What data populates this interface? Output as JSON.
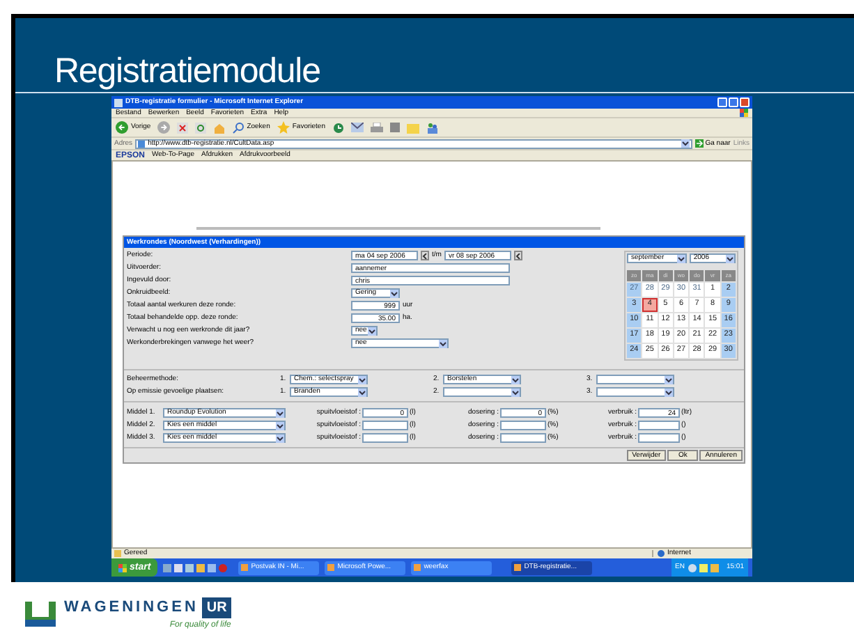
{
  "slide": {
    "title": "Registratiemodule",
    "logo_name": "WAGENINGEN",
    "logo_suffix": "UR",
    "tagline": "For quality of life"
  },
  "window": {
    "title": "DTB-registratie formulier - Microsoft Internet Explorer"
  },
  "menu": [
    "Bestand",
    "Bewerken",
    "Beeld",
    "Favorieten",
    "Extra",
    "Help"
  ],
  "toolbar": [
    {
      "kind": "back",
      "label": "Vorige"
    },
    {
      "kind": "forward"
    },
    {
      "kind": "stop"
    },
    {
      "kind": "refresh"
    },
    {
      "kind": "home"
    },
    {
      "kind": "search",
      "label": "Zoeken"
    },
    {
      "kind": "favorites",
      "label": "Favorieten"
    },
    {
      "kind": "history"
    },
    {
      "kind": "mail"
    },
    {
      "kind": "print"
    },
    {
      "kind": "edit"
    },
    {
      "kind": "folder"
    },
    {
      "kind": "people"
    }
  ],
  "address": {
    "label": "Adres",
    "value": "http://www.dtb-registratie.nl/CultData.asp",
    "go": "Ga naar",
    "links": "Links"
  },
  "epson_bar": {
    "brand": "EPSON",
    "items": [
      "Web-To-Page",
      "Afdrukken",
      "Afdrukvoorbeeld"
    ]
  },
  "form": {
    "title": "Werkrondes (Noordwest (Verhardingen))",
    "rows": [
      {
        "kind": "date",
        "label": "Periode:",
        "value": "ma 04 sep 2006",
        "separator": "t/m",
        "value2": "vr 08 sep 2006"
      },
      {
        "kind": "text",
        "label": "Uitvoerder:",
        "value": "aannemer"
      },
      {
        "kind": "text",
        "label": "Ingevuld door:",
        "value": "chris"
      },
      {
        "kind": "select",
        "label": "Onkruidbeeld:",
        "value": "Gering"
      },
      {
        "kind": "number",
        "label": "Totaal aantal werkuren deze ronde:",
        "value": "999",
        "unit": "uur"
      },
      {
        "kind": "number",
        "label": "Totaal behandelde opp. deze ronde:",
        "value": "35.00",
        "unit": "ha."
      },
      {
        "kind": "select",
        "label": "Verwacht u nog een werkronde dit jaar?",
        "value": "nee"
      },
      {
        "kind": "wideselect",
        "label": "Werkonderbrekingen vanwege het weer?",
        "value": "nee"
      }
    ],
    "calendar": {
      "month": "september",
      "year": "2006",
      "weekdays": [
        "zo",
        "ma",
        "di",
        "wo",
        "do",
        "vr",
        "za"
      ],
      "weeks": [
        [
          {
            "d": "27",
            "other": true,
            "selected": false
          },
          {
            "d": "28",
            "other": true,
            "selected": false
          },
          {
            "d": "29",
            "other": true,
            "selected": false
          },
          {
            "d": "30",
            "other": true,
            "selected": false
          },
          {
            "d": "31",
            "other": true,
            "selected": false
          },
          {
            "d": "1",
            "other": false,
            "selected": false
          },
          {
            "d": "2",
            "other": false,
            "selected": false
          }
        ],
        [
          {
            "d": "3",
            "other": false,
            "selected": false
          },
          {
            "d": "4",
            "other": false,
            "selected": true
          },
          {
            "d": "5",
            "other": false,
            "selected": false
          },
          {
            "d": "6",
            "other": false,
            "selected": false
          },
          {
            "d": "7",
            "other": false,
            "selected": false
          },
          {
            "d": "8",
            "other": false,
            "selected": false
          },
          {
            "d": "9",
            "other": false,
            "selected": false
          }
        ],
        [
          {
            "d": "10",
            "other": false,
            "selected": false
          },
          {
            "d": "11",
            "other": false,
            "selected": false
          },
          {
            "d": "12",
            "other": false,
            "selected": false
          },
          {
            "d": "13",
            "other": false,
            "selected": false
          },
          {
            "d": "14",
            "other": false,
            "selected": false
          },
          {
            "d": "15",
            "other": false,
            "selected": false
          },
          {
            "d": "16",
            "other": false,
            "selected": false
          }
        ],
        [
          {
            "d": "17",
            "other": false,
            "selected": false
          },
          {
            "d": "18",
            "other": false,
            "selected": false
          },
          {
            "d": "19",
            "other": false,
            "selected": false
          },
          {
            "d": "20",
            "other": false,
            "selected": false
          },
          {
            "d": "21",
            "other": false,
            "selected": false
          },
          {
            "d": "22",
            "other": false,
            "selected": false
          },
          {
            "d": "23",
            "other": false,
            "selected": false
          }
        ],
        [
          {
            "d": "24",
            "other": false,
            "selected": false
          },
          {
            "d": "25",
            "other": false,
            "selected": false
          },
          {
            "d": "26",
            "other": false,
            "selected": false
          },
          {
            "d": "27",
            "other": false,
            "selected": false
          },
          {
            "d": "28",
            "other": false,
            "selected": false
          },
          {
            "d": "29",
            "other": false,
            "selected": false
          },
          {
            "d": "30",
            "other": false,
            "selected": false
          }
        ]
      ]
    },
    "methods": [
      {
        "label": "Beheermethode:",
        "choices": [
          {
            "number": "1.",
            "value": "Chem.: selectspray"
          },
          {
            "number": "2.",
            "value": "Borstelen"
          },
          {
            "number": "3."
          }
        ]
      },
      {
        "label": "Op emissie gevoelige plaatsen:",
        "choices": [
          {
            "number": "1.",
            "value": "Branden"
          },
          {
            "number": "2."
          },
          {
            "number": "3."
          }
        ]
      }
    ],
    "agents": [
      {
        "label": "Middel 1.",
        "value": "Roundup Evolution",
        "spray_label": "spuitvloeistof :",
        "spray": "0",
        "spray_unit": "(l)",
        "dose_label": "dosering :",
        "dose": "0",
        "dose_unit": "(%)",
        "use_label": "verbruik :",
        "use": "24",
        "use_unit": "(ltr)"
      },
      {
        "label": "Middel 2.",
        "value": "Kies een middel",
        "spray_label": "spuitvloeistof :",
        "spray_unit": "(l)",
        "dose_label": "dosering :",
        "dose_unit": "(%)",
        "use_label": "verbruik :",
        "use_unit": "()"
      },
      {
        "label": "Middel 3.",
        "value": "Kies een middel",
        "spray_label": "spuitvloeistof :",
        "spray_unit": "(l)",
        "dose_label": "dosering :",
        "dose_unit": "(%)",
        "use_label": "verbruik :",
        "use_unit": "()"
      }
    ],
    "buttons": [
      "Verwijder",
      "Ok",
      "Annuleren"
    ]
  },
  "status_bar": {
    "text": "Gereed",
    "zone": "Internet"
  },
  "taskbar": {
    "start": "start",
    "tasks": [
      {
        "label": "Postvak IN - Mi...",
        "selected": false
      },
      {
        "label": "Microsoft Powe...",
        "selected": false
      },
      {
        "label": "weerfax",
        "selected": false
      },
      {
        "label": "DTB-registratie...",
        "selected": true
      }
    ],
    "language": "EN",
    "clock": "15:01"
  }
}
